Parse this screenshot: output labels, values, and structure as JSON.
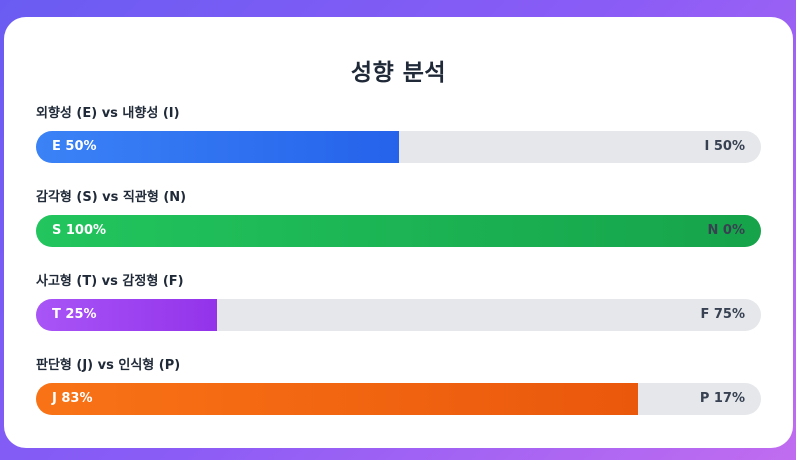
{
  "title": "성향 분석",
  "colors": {
    "blue": "#2563eb",
    "green": "#16a34a",
    "purple": "#9333ea",
    "orange": "#ea580c",
    "track": "#e5e7eb"
  },
  "dimensions": [
    {
      "label": "외향성 (E) vs 내향성 (I)",
      "left_text": "E 50%",
      "right_text": "I 50%",
      "left_percent": 50,
      "color": "blue"
    },
    {
      "label": "감각형 (S) vs 직관형 (N)",
      "left_text": "S 100%",
      "right_text": "N 0%",
      "left_percent": 100,
      "color": "green"
    },
    {
      "label": "사고형 (T) vs 감정형 (F)",
      "left_text": "T 25%",
      "right_text": "F 75%",
      "left_percent": 25,
      "color": "purple"
    },
    {
      "label": "판단형 (J) vs 인식형 (P)",
      "left_text": "J 83%",
      "right_text": "P 17%",
      "left_percent": 83,
      "color": "orange"
    }
  ]
}
